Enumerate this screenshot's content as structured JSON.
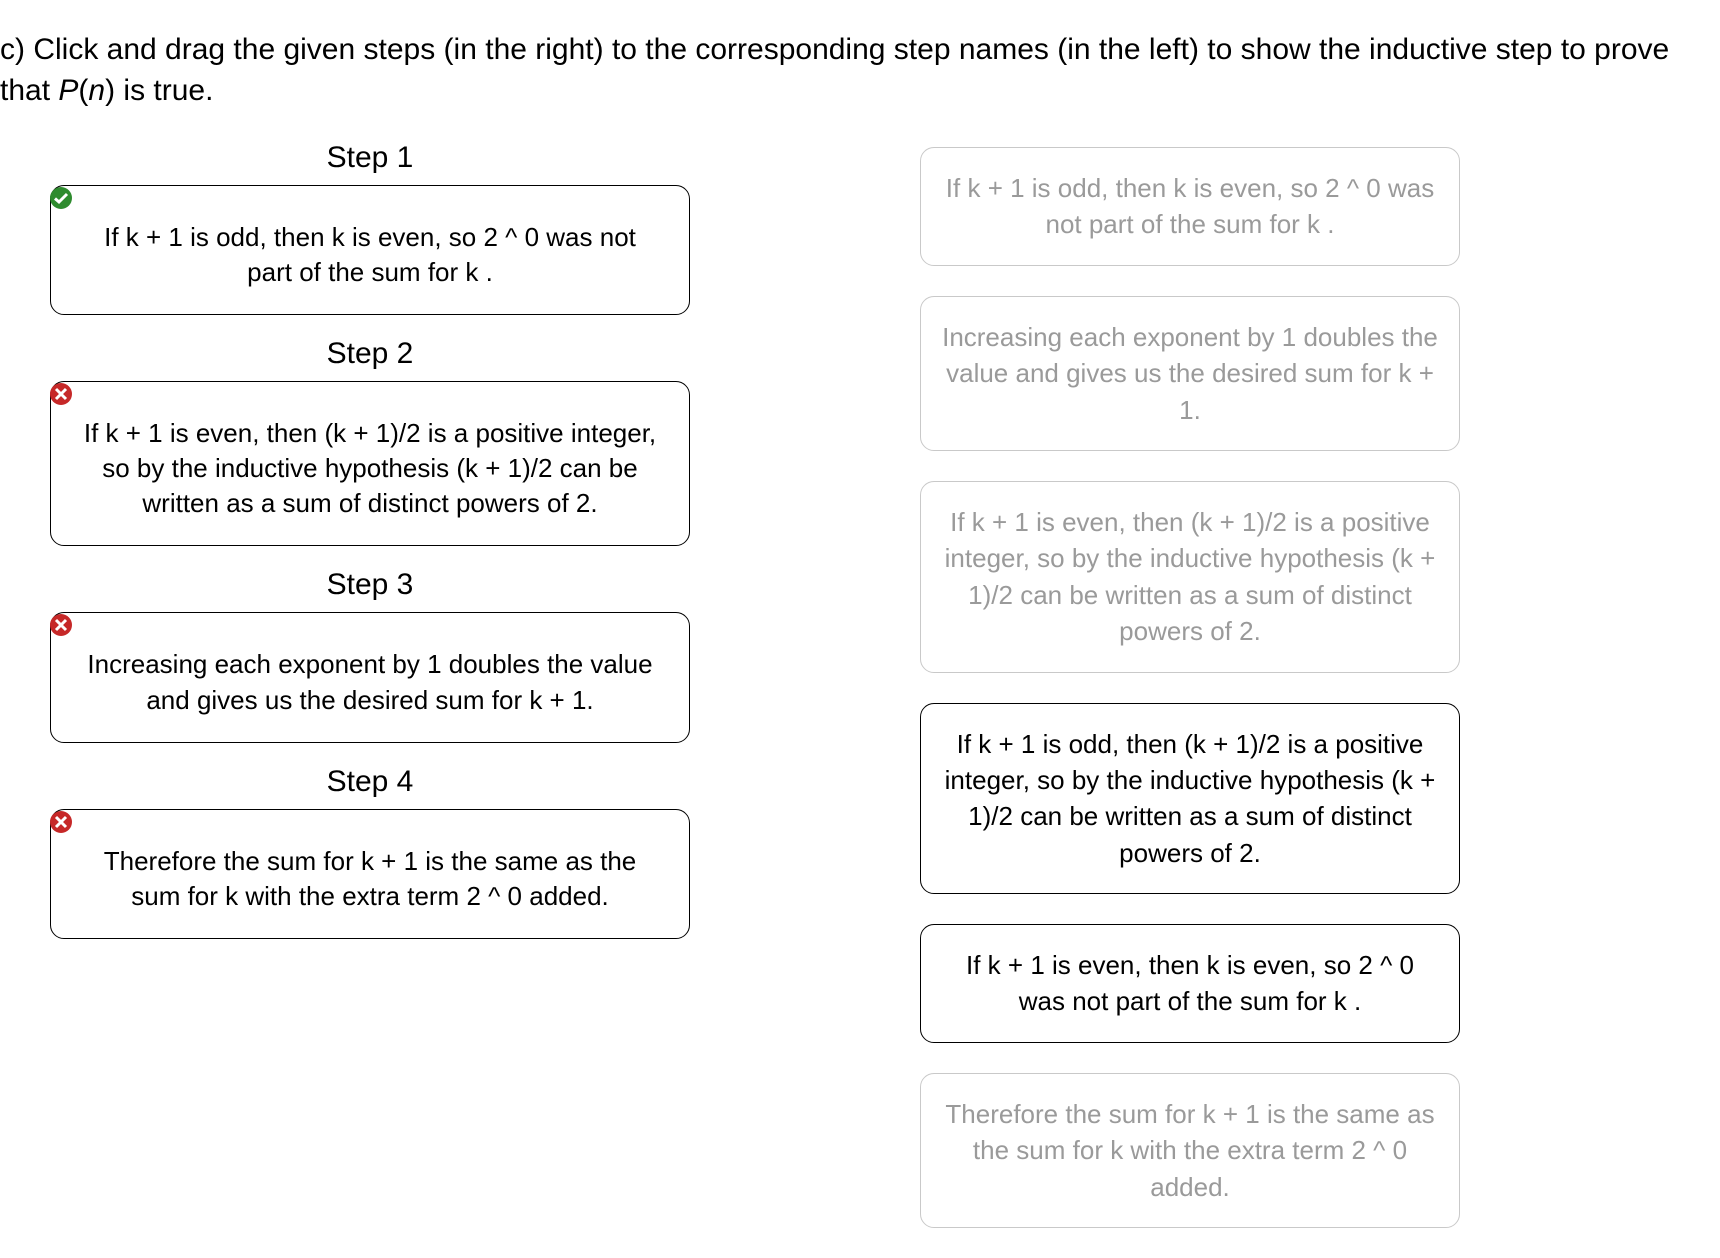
{
  "prompt_prefix": "c) Click and drag the given steps (in the right) to the corresponding step names (in the left) to show the inductive step to prove that ",
  "prompt_fn": "P",
  "prompt_arg": "n",
  "prompt_suffix": " is true.",
  "slots": [
    {
      "title": "Step 1",
      "status": "correct",
      "text": "If k + 1 is odd, then k is even, so 2 ^ 0 was not part of the sum for k ."
    },
    {
      "title": "Step 2",
      "status": "incorrect",
      "text": "If k + 1 is even, then (k + 1)/2 is a positive integer, so by the inductive hypothesis (k + 1)/2 can be written as a sum of distinct powers of 2."
    },
    {
      "title": "Step 3",
      "status": "incorrect",
      "text": "Increasing each exponent by 1 doubles the value and gives us the desired sum for k + 1."
    },
    {
      "title": "Step 4",
      "status": "incorrect",
      "text": "Therefore the sum for k + 1 is the same as the sum for k with the extra term 2 ^ 0 added."
    }
  ],
  "options": [
    {
      "text": "If k + 1 is odd, then k is even, so 2 ^ 0 was not part of the sum for k .",
      "used": true
    },
    {
      "text": "Increasing each exponent by 1 doubles the value and gives us the desired sum for k + 1.",
      "used": true
    },
    {
      "text": "If k + 1 is even, then (k + 1)/2 is a positive integer, so by the inductive hypothesis (k + 1)/2 can be written as a sum of distinct powers of 2.",
      "used": true
    },
    {
      "text": "If k + 1 is odd, then (k + 1)/2 is a positive integer, so by the inductive hypothesis (k + 1)/2 can be written as a sum of distinct powers of 2.",
      "used": false
    },
    {
      "text": "If k + 1 is even, then k is even, so 2 ^ 0 was not part of the sum for k .",
      "used": false
    },
    {
      "text": "Therefore the sum for k + 1 is the same as the sum for k with the extra term 2 ^ 0 added.",
      "used": true
    }
  ]
}
